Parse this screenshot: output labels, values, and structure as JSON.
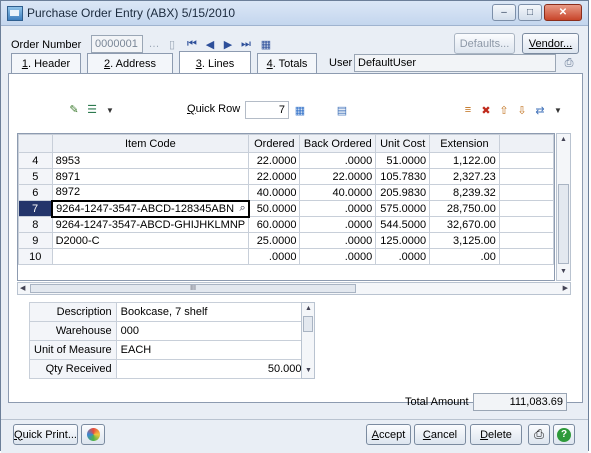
{
  "window": {
    "title": "Purchase Order Entry (ABX) 5/15/2010"
  },
  "header": {
    "order_number_label": "Order Number",
    "order_number_value": "0000001",
    "defaults_label": "Defaults...",
    "vendor_label": "Vendor..."
  },
  "tabs": [
    {
      "number": "1",
      "label": ". Header"
    },
    {
      "number": "2",
      "label": ". Address"
    },
    {
      "number": "3",
      "label": ". Lines"
    },
    {
      "number": "4",
      "label": ". Totals"
    }
  ],
  "user": {
    "label": "User",
    "value": "DefaultUser"
  },
  "toolbar": {
    "quick_row_label": "Quick Row",
    "quick_row_value": "7"
  },
  "grid": {
    "columns": [
      "Item Code",
      "Ordered",
      "Back Ordered",
      "Unit Cost",
      "Extension"
    ],
    "rows": [
      {
        "n": "4",
        "code": "8953",
        "ordered": "22.0000",
        "back": ".0000",
        "cost": "51.0000",
        "ext": "1,122.00"
      },
      {
        "n": "5",
        "code": "8971",
        "ordered": "22.0000",
        "back": "22.0000",
        "cost": "105.7830",
        "ext": "2,327.23"
      },
      {
        "n": "6",
        "code": "8972",
        "ordered": "40.0000",
        "back": "40.0000",
        "cost": "205.9830",
        "ext": "8,239.32"
      },
      {
        "n": "7",
        "code": "9264-1247-3547-ABCD-128345ABN",
        "ordered": "50.0000",
        "back": ".0000",
        "cost": "575.0000",
        "ext": "28,750.00"
      },
      {
        "n": "8",
        "code": "9264-1247-3547-ABCD-GHIJHKLMNP",
        "ordered": "60.0000",
        "back": ".0000",
        "cost": "544.5000",
        "ext": "32,670.00"
      },
      {
        "n": "9",
        "code": "D2000-C",
        "ordered": "25.0000",
        "back": ".0000",
        "cost": "125.0000",
        "ext": "3,125.00"
      },
      {
        "n": "10",
        "code": "",
        "ordered": ".0000",
        "back": ".0000",
        "cost": ".0000",
        "ext": ".00"
      }
    ],
    "hscroll_grip": "III"
  },
  "detail": {
    "rows": [
      {
        "key": "Description",
        "value": "Bookcase, 7 shelf"
      },
      {
        "key": "Warehouse",
        "value": "000"
      },
      {
        "key": "Unit of Measure",
        "value": "EACH"
      },
      {
        "key": "Qty Received",
        "value": "50.0000"
      }
    ]
  },
  "totals": {
    "label": "Total Amount",
    "value": "111,083.69"
  },
  "bottom": {
    "quick_print": "Quick Print...",
    "accept": "Accept",
    "cancel": "Cancel",
    "delete": "Delete"
  }
}
